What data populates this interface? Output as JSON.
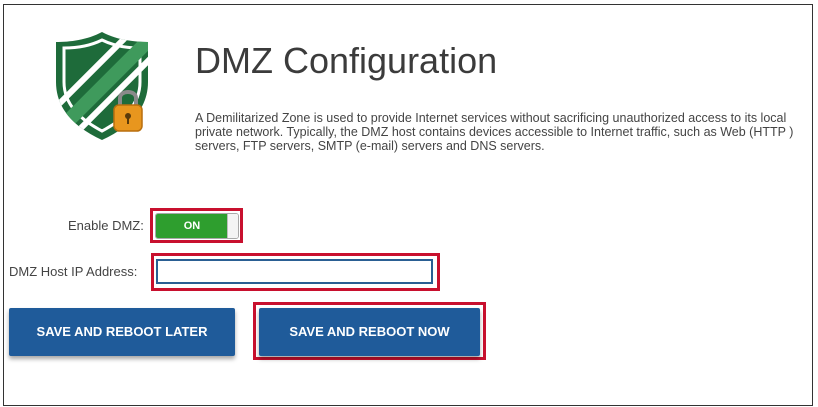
{
  "header": {
    "title": "DMZ Configuration",
    "description": "A Demilitarized Zone is used to provide Internet services without sacrificing unauthorized access to its local private network. Typically, the DMZ host contains devices accessible to Internet traffic, such as Web (HTTP ) servers, FTP servers, SMTP (e-mail) servers and DNS servers."
  },
  "form": {
    "enable_label": "Enable DMZ:",
    "toggle_state": "ON",
    "ip_label": "DMZ Host IP Address:",
    "ip_value": "",
    "ip_placeholder": ""
  },
  "buttons": {
    "save_later": "SAVE AND REBOOT LATER",
    "save_now": "SAVE AND REBOOT NOW"
  },
  "icons": {
    "logo": "shield-lock-icon"
  },
  "colors": {
    "shield_green": "#1e6b3a",
    "lock_orange": "#e8961e",
    "toggle_on": "#2e9e2e",
    "button_blue": "#1f5b9a",
    "highlight_red": "#c8102e"
  }
}
